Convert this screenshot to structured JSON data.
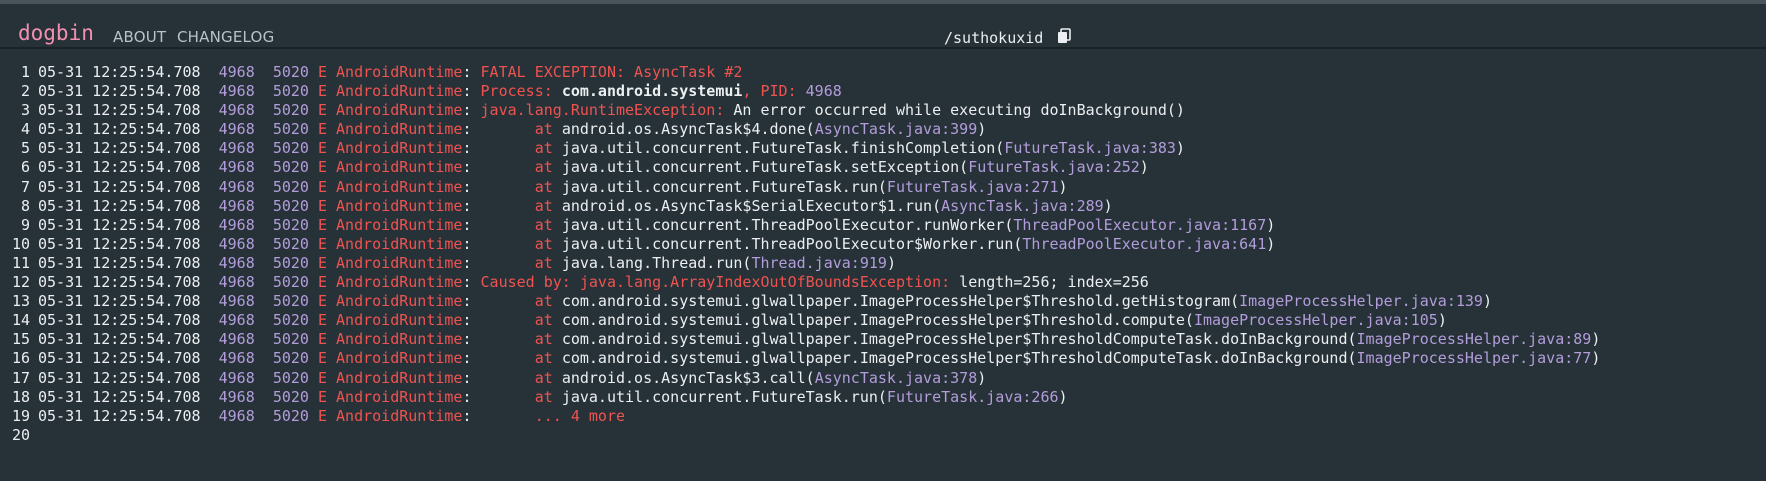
{
  "header": {
    "brand": "dogbin",
    "nav": [
      "ABOUT",
      "CHANGELOG"
    ],
    "doc_title": "/suthokuxid",
    "copy_icon": "copy-icon"
  },
  "log": {
    "prefix": {
      "timestamp": "05-31 12:25:54.708",
      "pid": "4968",
      "tid": "5020",
      "level": "E",
      "tag": "AndroidRuntime",
      "colon": ":"
    },
    "lines": [
      {
        "no": "1",
        "segs": [
          {
            "t": " FATAL EXCEPTION: AsyncTask #2",
            "c": "red"
          }
        ]
      },
      {
        "no": "2",
        "segs": [
          {
            "t": " Process: ",
            "c": "red"
          },
          {
            "t": "com.android.systemui",
            "c": "bold"
          },
          {
            "t": ", PID: ",
            "c": "red"
          },
          {
            "t": "4968",
            "c": "num"
          }
        ]
      },
      {
        "no": "3",
        "segs": [
          {
            "t": " java.lang.RuntimeException: ",
            "c": "red"
          },
          {
            "t": "An error occurred while executing doInBackground()",
            "c": "def"
          }
        ]
      },
      {
        "no": "4",
        "segs": [
          {
            "t": " \tat ",
            "c": "red"
          },
          {
            "t": "android.os.AsyncTask$4.done(",
            "c": "def"
          },
          {
            "t": "AsyncTask.java:399",
            "c": "link"
          },
          {
            "t": ")",
            "c": "def"
          }
        ]
      },
      {
        "no": "5",
        "segs": [
          {
            "t": " \tat ",
            "c": "red"
          },
          {
            "t": "java.util.concurrent.FutureTask.finishCompletion(",
            "c": "def"
          },
          {
            "t": "FutureTask.java:383",
            "c": "link"
          },
          {
            "t": ")",
            "c": "def"
          }
        ]
      },
      {
        "no": "6",
        "segs": [
          {
            "t": " \tat ",
            "c": "red"
          },
          {
            "t": "java.util.concurrent.FutureTask.setException(",
            "c": "def"
          },
          {
            "t": "FutureTask.java:252",
            "c": "link"
          },
          {
            "t": ")",
            "c": "def"
          }
        ]
      },
      {
        "no": "7",
        "segs": [
          {
            "t": " \tat ",
            "c": "red"
          },
          {
            "t": "java.util.concurrent.FutureTask.run(",
            "c": "def"
          },
          {
            "t": "FutureTask.java:271",
            "c": "link"
          },
          {
            "t": ")",
            "c": "def"
          }
        ]
      },
      {
        "no": "8",
        "segs": [
          {
            "t": " \tat ",
            "c": "red"
          },
          {
            "t": "android.os.AsyncTask$SerialExecutor$1.run(",
            "c": "def"
          },
          {
            "t": "AsyncTask.java:289",
            "c": "link"
          },
          {
            "t": ")",
            "c": "def"
          }
        ]
      },
      {
        "no": "9",
        "segs": [
          {
            "t": " \tat ",
            "c": "red"
          },
          {
            "t": "java.util.concurrent.ThreadPoolExecutor.runWorker(",
            "c": "def"
          },
          {
            "t": "ThreadPoolExecutor.java:1167",
            "c": "link"
          },
          {
            "t": ")",
            "c": "def"
          }
        ]
      },
      {
        "no": "10",
        "segs": [
          {
            "t": " \tat ",
            "c": "red"
          },
          {
            "t": "java.util.concurrent.ThreadPoolExecutor$Worker.run(",
            "c": "def"
          },
          {
            "t": "ThreadPoolExecutor.java:641",
            "c": "link"
          },
          {
            "t": ")",
            "c": "def"
          }
        ]
      },
      {
        "no": "11",
        "segs": [
          {
            "t": " \tat ",
            "c": "red"
          },
          {
            "t": "java.lang.Thread.run(",
            "c": "def"
          },
          {
            "t": "Thread.java:919",
            "c": "link"
          },
          {
            "t": ")",
            "c": "def"
          }
        ]
      },
      {
        "no": "12",
        "segs": [
          {
            "t": " Caused by: java.lang.ArrayIndexOutOfBoundsException: ",
            "c": "red"
          },
          {
            "t": "length=256; index=256",
            "c": "def"
          }
        ]
      },
      {
        "no": "13",
        "segs": [
          {
            "t": " \tat ",
            "c": "red"
          },
          {
            "t": "com.android.systemui.glwallpaper.ImageProcessHelper$Threshold.getHistogram(",
            "c": "def"
          },
          {
            "t": "ImageProcessHelper.java:139",
            "c": "link"
          },
          {
            "t": ")",
            "c": "def"
          }
        ]
      },
      {
        "no": "14",
        "segs": [
          {
            "t": " \tat ",
            "c": "red"
          },
          {
            "t": "com.android.systemui.glwallpaper.ImageProcessHelper$Threshold.compute(",
            "c": "def"
          },
          {
            "t": "ImageProcessHelper.java:105",
            "c": "link"
          },
          {
            "t": ")",
            "c": "def"
          }
        ]
      },
      {
        "no": "15",
        "segs": [
          {
            "t": " \tat ",
            "c": "red"
          },
          {
            "t": "com.android.systemui.glwallpaper.ImageProcessHelper$ThresholdComputeTask.doInBackground(",
            "c": "def"
          },
          {
            "t": "ImageProcessHelper.java:89",
            "c": "link"
          },
          {
            "t": ")",
            "c": "def"
          }
        ]
      },
      {
        "no": "16",
        "segs": [
          {
            "t": " \tat ",
            "c": "red"
          },
          {
            "t": "com.android.systemui.glwallpaper.ImageProcessHelper$ThresholdComputeTask.doInBackground(",
            "c": "def"
          },
          {
            "t": "ImageProcessHelper.java:77",
            "c": "link"
          },
          {
            "t": ")",
            "c": "def"
          }
        ]
      },
      {
        "no": "17",
        "segs": [
          {
            "t": " \tat ",
            "c": "red"
          },
          {
            "t": "android.os.AsyncTask$3.call(",
            "c": "def"
          },
          {
            "t": "AsyncTask.java:378",
            "c": "link"
          },
          {
            "t": ")",
            "c": "def"
          }
        ]
      },
      {
        "no": "18",
        "segs": [
          {
            "t": " \tat ",
            "c": "red"
          },
          {
            "t": "java.util.concurrent.FutureTask.run(",
            "c": "def"
          },
          {
            "t": "FutureTask.java:266",
            "c": "link"
          },
          {
            "t": ")",
            "c": "def"
          }
        ]
      },
      {
        "no": "19",
        "segs": [
          {
            "t": " \t... 4 more",
            "c": "red"
          }
        ]
      },
      {
        "no": "20",
        "segs": []
      }
    ]
  },
  "colors": {
    "background": "#263238",
    "brand": "#f48fb1",
    "text": "#eceff1",
    "number": "#b39ddb",
    "error": "#ef5350"
  }
}
